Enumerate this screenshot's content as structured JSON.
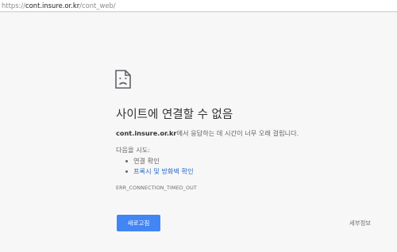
{
  "address_bar": {
    "scheme": "https://",
    "host": "cont.insure.or.kr",
    "path": "/cont_web/"
  },
  "error": {
    "icon": "sad-page-icon",
    "title": "사이트에 연결할 수 없음",
    "host": "cont.insure.or.kr",
    "description_suffix": "에서 응답하는 데 시간이 너무 오래 걸립니다.",
    "suggestions_heading": "다음을 시도:",
    "suggestions": [
      {
        "label": "연결 확인",
        "is_link": false
      },
      {
        "label": "프록시 및 방화벽 확인",
        "is_link": true
      }
    ],
    "code": "ERR_CONNECTION_TIMED_OUT"
  },
  "buttons": {
    "reload_label": "새로고침",
    "details_label": "세부정보"
  },
  "colors": {
    "background": "#f7f7f7",
    "primary_button": "#4285f4",
    "link": "#2a6acb",
    "text": "#333333",
    "secondary_text": "#646464"
  }
}
